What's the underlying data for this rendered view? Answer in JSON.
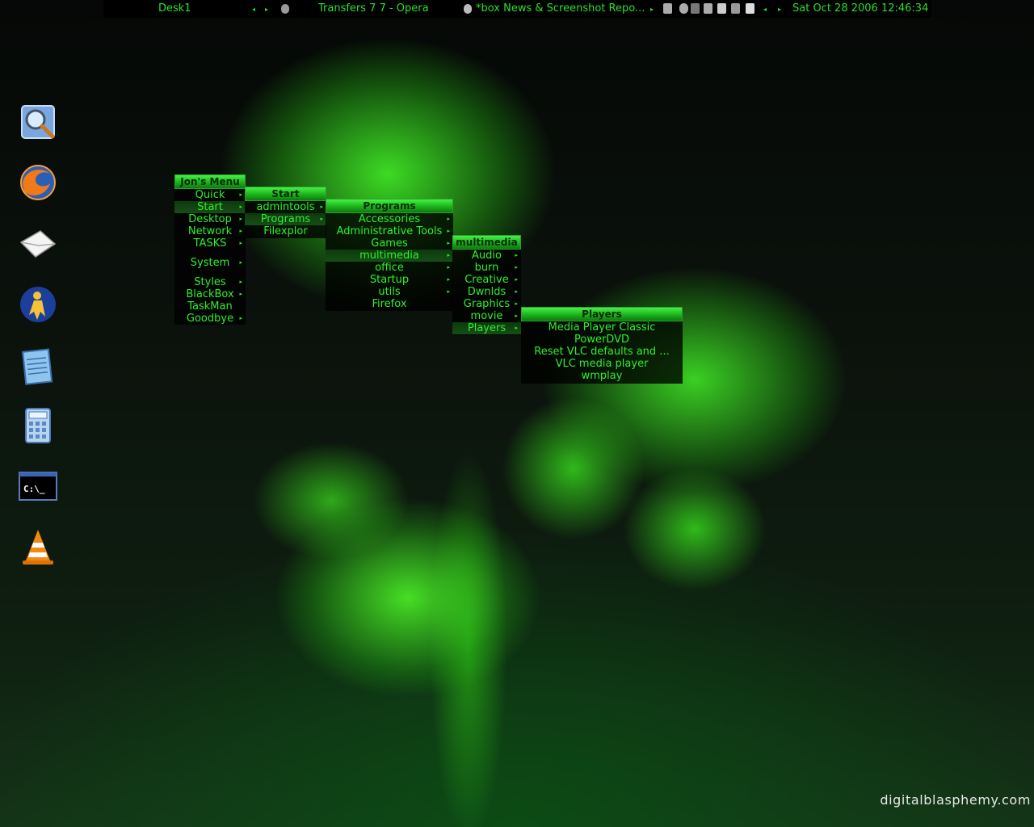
{
  "topbar": {
    "workspace": "Desk1",
    "prev_arrow": "◂",
    "next_arrow": "▸",
    "window_title": "Transfers 7 7 - Opera",
    "window_title_2": "*box News & Screenshot Repo...",
    "clock": "Sat Oct 28 2006 12:46:34"
  },
  "desktop_icons": [
    {
      "name": "search-icon"
    },
    {
      "name": "firefox-icon"
    },
    {
      "name": "mail-icon"
    },
    {
      "name": "messenger-icon"
    },
    {
      "name": "notepad-icon"
    },
    {
      "name": "calculator-icon"
    },
    {
      "name": "command-prompt-icon",
      "label": "C:\\_"
    },
    {
      "name": "vlc-icon"
    }
  ],
  "menus": {
    "root": {
      "title": "Jon's Menu",
      "items": [
        "Quick",
        "Start",
        "Desktop",
        "Network",
        "TASKS",
        "System",
        "Styles",
        "BlackBox",
        "TaskMan",
        "Goodbye"
      ]
    },
    "start": {
      "title": "Start",
      "items": [
        "admintools",
        "Programs",
        "Filexplor"
      ]
    },
    "programs": {
      "title": "Programs",
      "items": [
        "Accessories",
        "Administrative Tools",
        "Games",
        "multimedia",
        "office",
        "Startup",
        "utils",
        "Firefox"
      ]
    },
    "multimedia": {
      "title": "multimedia",
      "items": [
        "Audio",
        "burn",
        "Creative",
        "Dwnlds",
        "Graphics",
        "movie",
        "Players"
      ]
    },
    "players": {
      "title": "Players",
      "items": [
        "Media Player Classic",
        "PowerDVD",
        "Reset VLC defaults and ...",
        "VLC media player",
        "wmplay"
      ]
    }
  },
  "submenu_arrow": "▸",
  "watermark": "digitalblasphemy.com",
  "colors": {
    "menu_text": "#2df02d",
    "menu_title_bg": "#1fb81f",
    "topbar_text": "#28e028"
  }
}
